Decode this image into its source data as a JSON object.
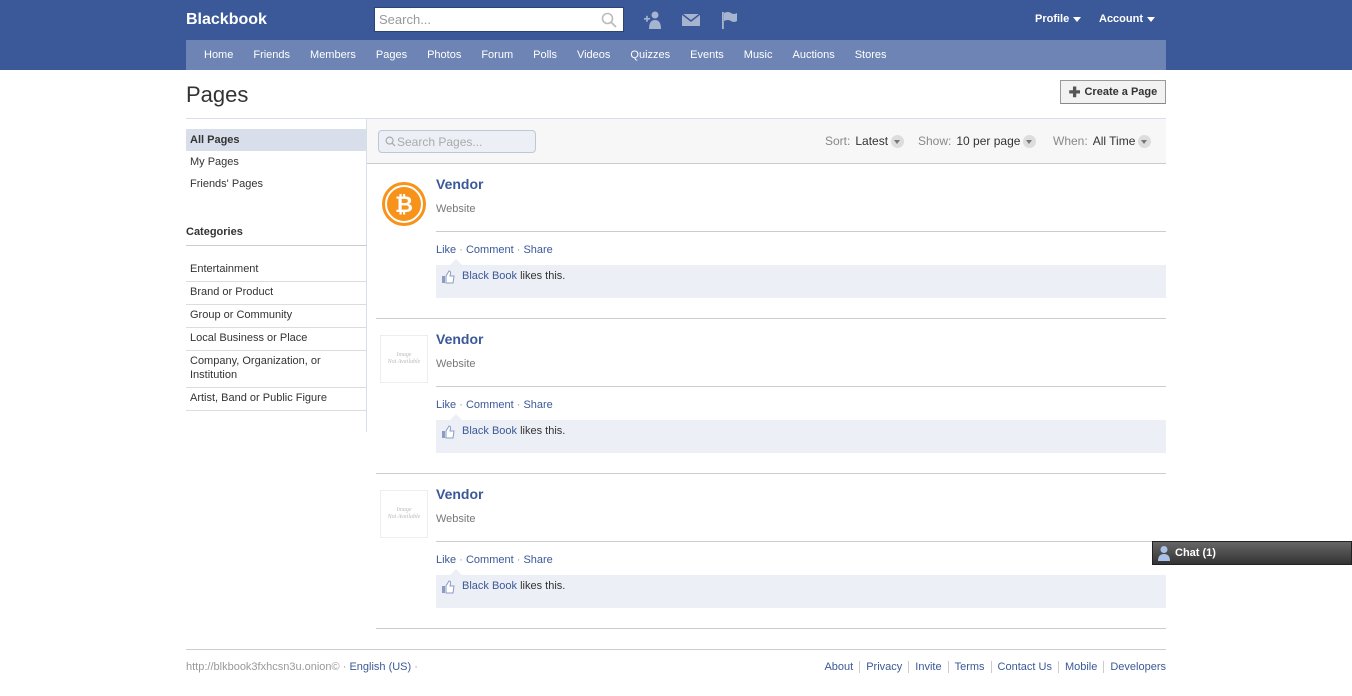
{
  "header": {
    "brand": "Blackbook",
    "search_placeholder": "Search...",
    "icons": [
      "friend-requests-icon",
      "messages-icon",
      "notifications-icon"
    ],
    "profile_label": "Profile",
    "account_label": "Account",
    "bg_color": "#3b5998",
    "nav_color": "#6d84b4"
  },
  "nav": {
    "items": [
      "Home",
      "Friends",
      "Members",
      "Pages",
      "Photos",
      "Forum",
      "Polls",
      "Videos",
      "Quizzes",
      "Events",
      "Music",
      "Auctions",
      "Stores"
    ]
  },
  "page": {
    "title": "Pages",
    "create_button": "Create a Page"
  },
  "sidebar": {
    "links": [
      "All Pages",
      "My Pages",
      "Friends' Pages"
    ],
    "active": "All Pages",
    "categories_heading": "Categories",
    "categories": [
      "Entertainment",
      "Brand or Product",
      "Group or Community",
      "Local Business or Place",
      "Company, Organization, or Institution",
      "Artist, Band or Public Figure"
    ]
  },
  "filters": {
    "search_placeholder": "Search Pages...",
    "sort_label": "Sort:",
    "sort_value": "Latest",
    "show_label": "Show:",
    "show_value": "10 per page",
    "when_label": "When:",
    "when_value": "All Time"
  },
  "entries": [
    {
      "title": "Vendor",
      "type": "Website",
      "image": "bitcoin-logo",
      "actions": [
        "Like",
        "Comment",
        "Share"
      ],
      "liker": "Black Book",
      "like_suffix": "likes this."
    },
    {
      "title": "Vendor",
      "type": "Website",
      "image": "image-not-available",
      "actions": [
        "Like",
        "Comment",
        "Share"
      ],
      "liker": "Black Book",
      "like_suffix": "likes this."
    },
    {
      "title": "Vendor",
      "type": "Website",
      "image": "image-not-available",
      "actions": [
        "Like",
        "Comment",
        "Share"
      ],
      "liker": "Black Book",
      "like_suffix": "likes this."
    }
  ],
  "chat": {
    "label": "Chat (1)"
  },
  "footer": {
    "site": "http://blkbook3fxhcsn3u.onion©",
    "language": "English (US)",
    "links": [
      "About",
      "Privacy",
      "Invite",
      "Terms",
      "Contact Us",
      "Mobile",
      "Developers"
    ]
  }
}
